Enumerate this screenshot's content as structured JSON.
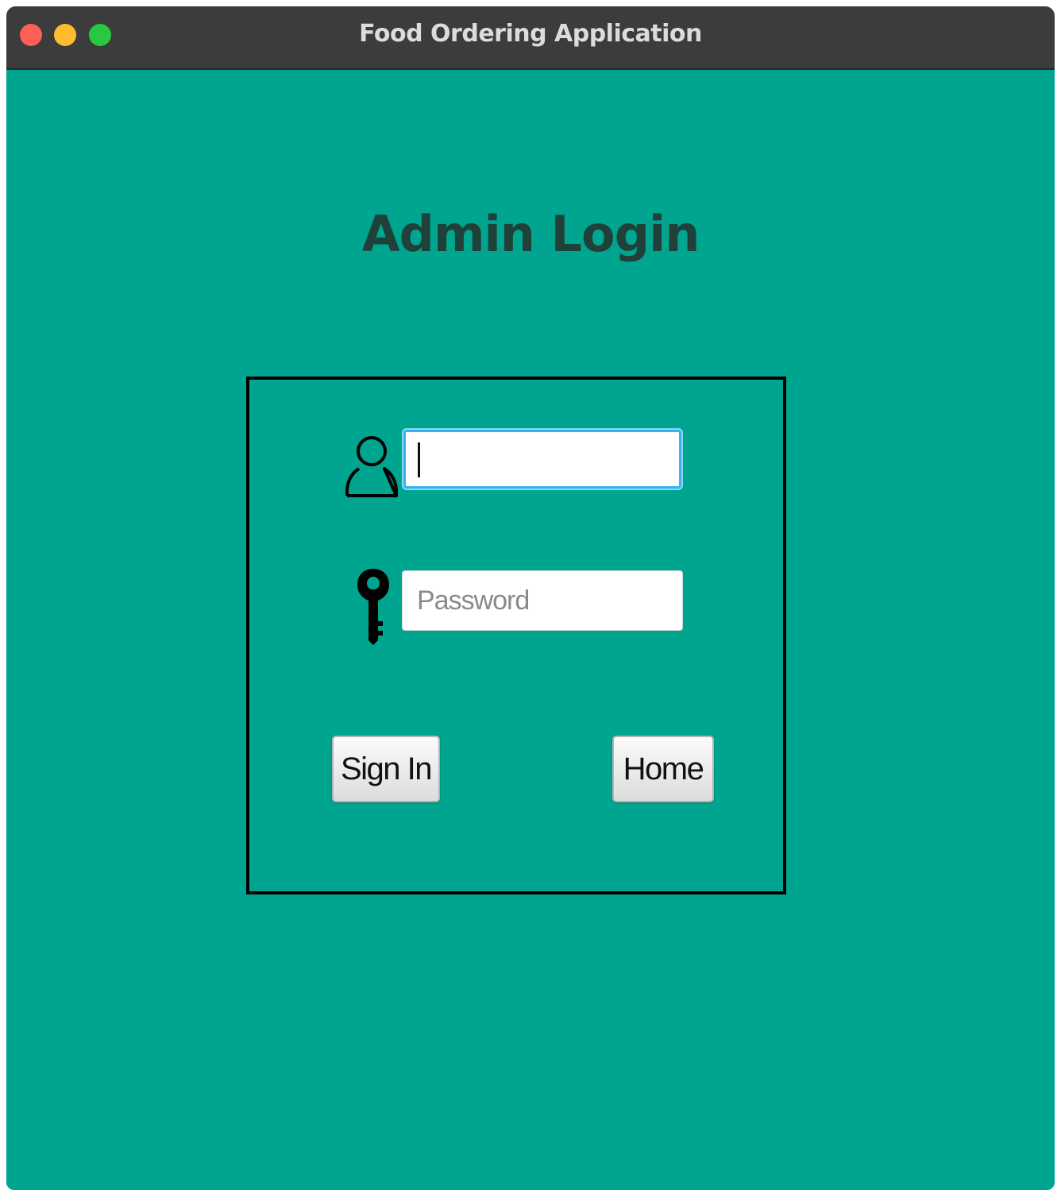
{
  "window": {
    "title": "Food Ordering Application"
  },
  "page": {
    "heading": "Admin Login"
  },
  "form": {
    "username": {
      "value": "",
      "placeholder": ""
    },
    "password": {
      "value": "",
      "placeholder": "Password"
    },
    "signin_label": "Sign In",
    "home_label": "Home"
  },
  "icons": {
    "username": "user-icon",
    "password": "key-icon"
  },
  "colors": {
    "background": "#00a58f",
    "titlebar": "#3c3c3c",
    "heading": "#20403a",
    "focus_ring": "#32b4f0"
  }
}
